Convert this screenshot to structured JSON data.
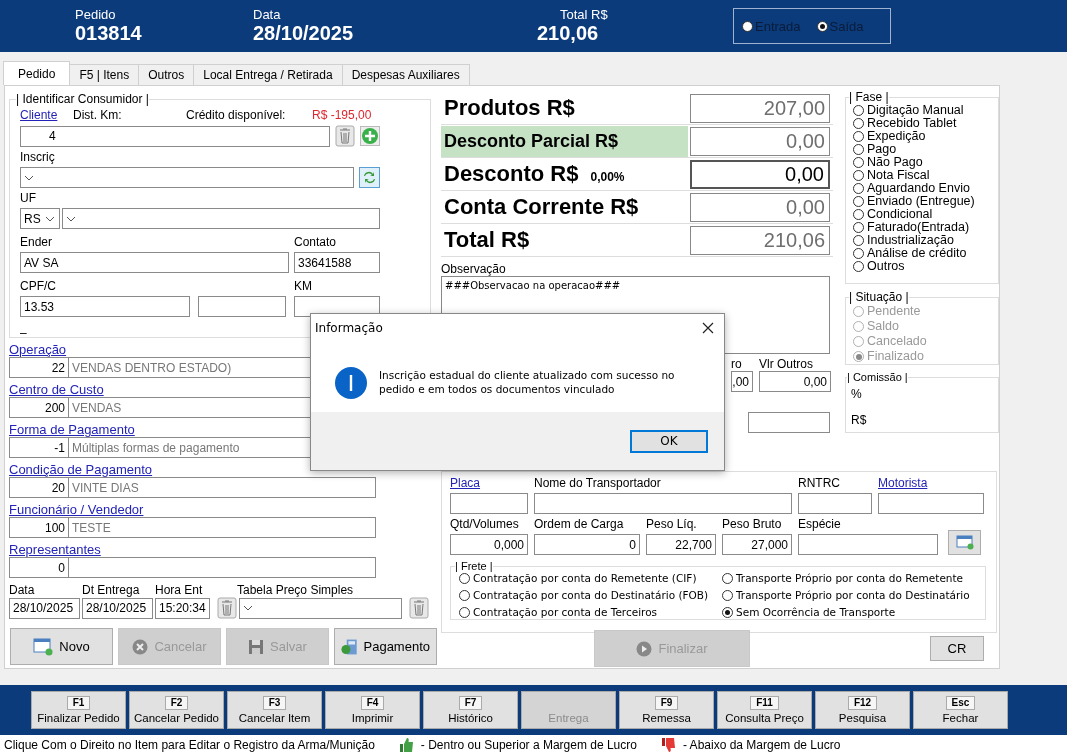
{
  "header": {
    "fields": [
      {
        "label": "Pedido",
        "value": "013814"
      },
      {
        "label": "Data",
        "value": "28/10/2025"
      },
      {
        "label": "Total R$",
        "value": "210,06"
      }
    ],
    "tipo": [
      {
        "label": "Entrada",
        "selected": false
      },
      {
        "label": "Saída",
        "selected": true
      }
    ]
  },
  "tabs": [
    {
      "label": "Pedido",
      "selected": true
    },
    {
      "label": "F5 | Itens",
      "selected": false
    },
    {
      "label": "Outros",
      "selected": false
    },
    {
      "label": "Local Entrega  / Retirada",
      "selected": false
    },
    {
      "label": "Despesas Auxiliares",
      "selected": false
    }
  ],
  "consumidor": {
    "legend": "| Identificar Consumidor |",
    "cliente_link": "Cliente",
    "dist_label": "Dist. Km:",
    "credito_label": "Crédito disponível:",
    "credito_value": "R$ -195,00",
    "cliente_code": "4",
    "inscricao_label": "Inscriç",
    "uf_label": "UF",
    "uf_value": "RS",
    "endereco_label": "Ender",
    "endereco_value": "AV SA",
    "contato_label": "Contato",
    "contato_value": "33641588",
    "cpf_label": "CPF/C",
    "cpf_value": "13.53",
    "km_label": "KM",
    "footer": "–"
  },
  "lookups": [
    {
      "label": "Operação",
      "code": "22",
      "description": "VENDAS DENTRO ESTADO)"
    },
    {
      "label": "Centro de Custo",
      "code": "200",
      "description": "VENDAS"
    },
    {
      "label": "Forma de Pagamento",
      "code": "-1",
      "description": "Múltiplas formas de pagamento"
    },
    {
      "label": "Condição de Pagamento",
      "code": "20",
      "description": "VINTE DIAS"
    },
    {
      "label": "Funcionário / Vendedor",
      "code": "100",
      "description": "TESTE"
    },
    {
      "label": "Representantes",
      "code": "0"
    }
  ],
  "dates": [
    {
      "label": "Data",
      "value": "28/10/2025"
    },
    {
      "label": "Dt Entrega",
      "value": "28/10/2025"
    },
    {
      "label": "Hora Ent",
      "value": "15:20:34"
    }
  ],
  "tabela_label": "Tabela Preço Simples",
  "left_buttons": [
    {
      "label": "Novo",
      "kind": "new",
      "disabled": false
    },
    {
      "label": "Cancelar",
      "kind": "cancel",
      "disabled": true
    },
    {
      "label": "Salvar",
      "kind": "save",
      "disabled": true
    },
    {
      "label": "Pagamento",
      "kind": "payment",
      "disabled": false
    }
  ],
  "totals": [
    {
      "label": "Produtos R$",
      "value": "207,00",
      "highlighted": false,
      "editable": false
    },
    {
      "label": "Desconto Parcial R$",
      "value": "0,00",
      "highlighted": true,
      "editable": false
    },
    {
      "label": "Desconto R$",
      "percent": "0,00%",
      "value": "0,00",
      "highlighted": false,
      "editable": true
    },
    {
      "label": "Conta Corrente R$",
      "value": "0,00",
      "highlighted": false,
      "editable": false
    },
    {
      "label": "Total R$",
      "value": "210,06",
      "highlighted": false,
      "editable": false
    }
  ],
  "observacao": {
    "label": "Observação",
    "text": "###Observacao na operacao###"
  },
  "outros": [
    {
      "label": "ro",
      "value": ",00"
    },
    {
      "label": "Vlr Outros",
      "value": "0,00"
    }
  ],
  "transporte": {
    "vehicle_fields": [
      {
        "label": "Placa",
        "link": true
      },
      {
        "label": "Nome do Transportador",
        "link": false
      },
      {
        "label": "RNTRC",
        "link": false
      },
      {
        "label": "Motorista",
        "link": true
      }
    ],
    "load_fields": [
      {
        "label": "Qtd/Volumes",
        "value": "0,000",
        "link": false
      },
      {
        "label": "Ordem de Carga",
        "value": "0",
        "link": false
      },
      {
        "label": "Peso Líq.",
        "value": "22,700",
        "link": false
      },
      {
        "label": "Peso Bruto",
        "value": "27,000",
        "link": false
      },
      {
        "label": "Espécie",
        "link": false
      }
    ],
    "frete_legend": "| Frete |",
    "frete": [
      {
        "label": "Contratação por conta do Remetente (CIF)",
        "selected": false
      },
      {
        "label": "Contratação por conta do Destinatário (FOB)",
        "selected": false
      },
      {
        "label": "Contratação por conta de Terceiros",
        "selected": false
      },
      {
        "label": "Transporte Próprio por conta do Remetente",
        "selected": false
      },
      {
        "label": "Transporte Próprio por conta do Destinatário",
        "selected": false
      },
      {
        "label": "Sem Ocorrência de Transporte",
        "selected": true
      }
    ]
  },
  "finalizar": {
    "label": "Finalizar",
    "disabled": true
  },
  "cr": {
    "label": "CR",
    "disabled": false
  },
  "fase": {
    "legend": "| Fase |",
    "options": [
      {
        "label": "Digitação Manual",
        "selected": false
      },
      {
        "label": "Recebido Tablet",
        "selected": false
      },
      {
        "label": "Expedição",
        "selected": false
      },
      {
        "label": "Pago",
        "selected": false
      },
      {
        "label": "Não Pago",
        "selected": false
      },
      {
        "label": "Nota Fiscal",
        "selected": false
      },
      {
        "label": "Aguardando Envio",
        "selected": false
      },
      {
        "label": "Enviado (Entregue)",
        "selected": false
      },
      {
        "label": "Condicional",
        "selected": false
      },
      {
        "label": "Faturado(Entrada)",
        "selected": false
      },
      {
        "label": "Industrialização",
        "selected": false
      },
      {
        "label": "Análise de crédito",
        "selected": false
      },
      {
        "label": "Outros",
        "selected": false
      }
    ]
  },
  "situacao": {
    "legend": "| Situação |",
    "disabled": true,
    "options": [
      {
        "label": "Pendente",
        "selected": false
      },
      {
        "label": "Saldo",
        "selected": false
      },
      {
        "label": "Cancelado",
        "selected": false
      },
      {
        "label": "Finalizado",
        "selected": true
      }
    ]
  },
  "comissao": {
    "legend": "| Comissão |",
    "lines": [
      "%",
      "R$"
    ]
  },
  "dialog": {
    "title": "Informação",
    "message": "Inscrição estadual do cliente atualizado com sucesso no pedido e em todos os documentos vinculado",
    "ok": "OK"
  },
  "function_keys": [
    {
      "key": "F1",
      "label": "Finalizar Pedido",
      "disabled": false
    },
    {
      "key": "F2",
      "label": "Cancelar Pedido",
      "disabled": false
    },
    {
      "key": "F3",
      "label": "Cancelar Item",
      "disabled": false
    },
    {
      "key": "F4",
      "label": "Imprimir",
      "disabled": false
    },
    {
      "key": "F7",
      "label": "Histórico",
      "disabled": false
    },
    {
      "label": "Entrega",
      "disabled": true
    },
    {
      "key": "F9",
      "label": "Remessa",
      "disabled": false
    },
    {
      "key": "F11",
      "label": "Consulta Preço",
      "disabled": false
    },
    {
      "key": "F12",
      "label": "Pesquisa",
      "disabled": false
    },
    {
      "key": "Esc",
      "label": "Fechar",
      "disabled": false
    }
  ],
  "status": [
    {
      "text": "Clique Com o Direito no Item para Editar o Registro da Arma/Munição"
    },
    {
      "kind": "margin_up",
      "text": "- Dentro ou Superior a Margem de Lucro"
    },
    {
      "kind": "margin_down",
      "text": "- Abaixo da Margem de Lucro"
    }
  ]
}
